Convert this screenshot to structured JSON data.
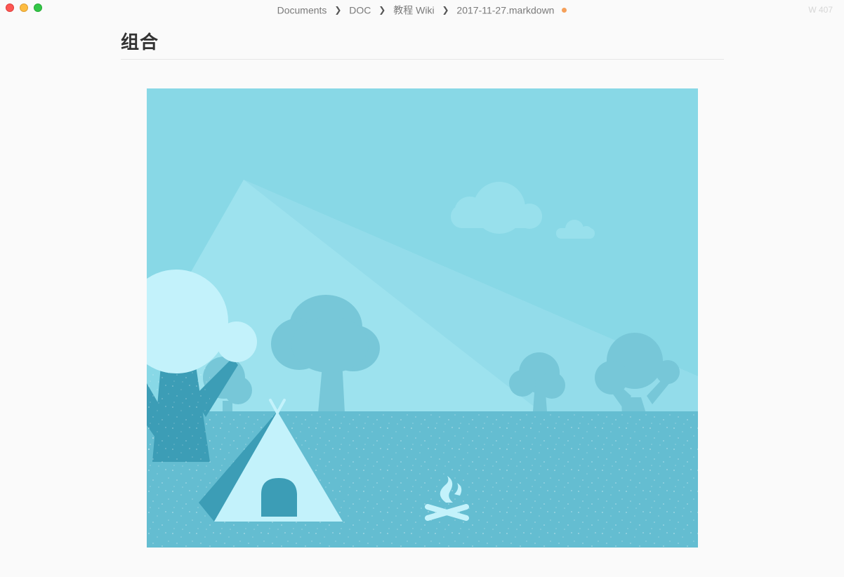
{
  "window": {
    "controls": [
      "close",
      "minimize",
      "maximize"
    ]
  },
  "breadcrumb": {
    "items": [
      "Documents",
      "DOC",
      "教程 Wiki",
      "2017-11-27.markdown"
    ],
    "separator_icon": "chevron-right-icon",
    "unsaved_indicator_color": "#f5a05a"
  },
  "status": {
    "word_count": "W 407"
  },
  "document": {
    "heading": "组合",
    "image": {
      "content": "camping-landscape-illustration",
      "colors": {
        "sky": "#88d8e6",
        "ground": "#63bdd1",
        "mountain": "#9ce2ee",
        "tree": "#78c8da",
        "tent": "#c6f4fb",
        "dark": "#3a9ab4"
      }
    }
  }
}
